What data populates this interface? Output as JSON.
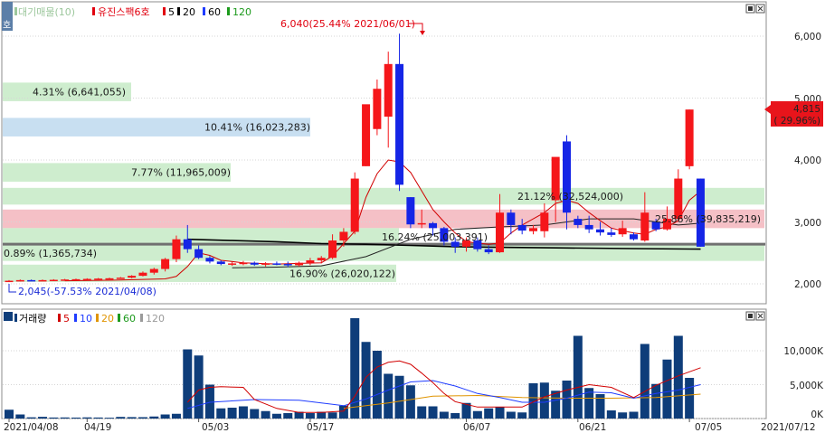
{
  "colors": {
    "up": "#f5161a",
    "down": "#1525e6",
    "ma5": "#d10000",
    "ma10": "#1f3cff",
    "ma20": "#e09400",
    "ma60": "#1c9a1c",
    "ma120": "#9a9a9a",
    "ma_trend": "#000000",
    "volume": "#0e3d7a",
    "band_green": "#c9ebc9",
    "band_blue": "#c2dcef",
    "band_red": "#f4b9c0",
    "price_tag": "#e8141b"
  },
  "price_panel": {
    "legend": {
      "item1": "대기매물(10)",
      "item2": "유진스팩6호",
      "ma5": "5",
      "ma20": "20",
      "ma60": "60",
      "ma120": "120"
    },
    "corner_tab": "호",
    "y_ticks": [
      "6,000",
      "5,000",
      "4,000",
      "3,000",
      "2,000"
    ],
    "max_annotation": "6,040(25.44% 2021/06/01)",
    "min_annotation": "2,045(-57.53% 2021/04/08)",
    "current_price": "4,815",
    "current_change": "( 29.96%)",
    "overhang_labels": [
      "4.31% (6,641,055)",
      "10.41% (16,023,283)",
      "7.77% (11,965,009)",
      "21.12% (32,524,000)",
      "25.86% (39,835,219)",
      "16.24% (25,003,391)",
      "0.89% (1,365,734)",
      "16.90% (26,020,122)"
    ]
  },
  "volume_panel": {
    "legend": {
      "title": "거래량",
      "ma5": "5",
      "ma10": "10",
      "ma20": "20",
      "ma60": "60",
      "ma120": "120"
    },
    "y_ticks": [
      "10,000K",
      "5,000K",
      "0K"
    ]
  },
  "x_ticks": [
    "2021/04/08",
    "04/19",
    "05/03",
    "05/17",
    "06/07",
    "06/21",
    "07/05",
    "2021/07/12"
  ],
  "chart_data": [
    {
      "type": "candlestick",
      "title": "유진스팩6호",
      "ylim": [
        1600,
        6500
      ],
      "y_ticks": [
        2000,
        3000,
        4000,
        5000,
        6000
      ],
      "candles": [
        [
          2045,
          2060,
          2040,
          2050
        ],
        [
          2050,
          2070,
          2040,
          2060
        ],
        [
          2060,
          2070,
          2050,
          2055
        ],
        [
          2055,
          2070,
          2050,
          2060
        ],
        [
          2060,
          2075,
          2050,
          2065
        ],
        [
          2065,
          2080,
          2055,
          2070
        ],
        [
          2070,
          2085,
          2060,
          2075
        ],
        [
          2075,
          2090,
          2065,
          2080
        ],
        [
          2080,
          2095,
          2070,
          2085
        ],
        [
          2085,
          2100,
          2075,
          2090
        ],
        [
          2090,
          2110,
          2080,
          2100
        ],
        [
          2100,
          2140,
          2090,
          2130
        ],
        [
          2130,
          2200,
          2120,
          2180
        ],
        [
          2180,
          2260,
          2150,
          2240
        ],
        [
          2240,
          2420,
          2200,
          2400
        ],
        [
          2400,
          2780,
          2350,
          2720
        ],
        [
          2720,
          2950,
          2500,
          2560
        ],
        [
          2560,
          2620,
          2400,
          2420
        ],
        [
          2420,
          2450,
          2330,
          2360
        ],
        [
          2360,
          2380,
          2300,
          2320
        ],
        [
          2320,
          2360,
          2290,
          2330
        ],
        [
          2330,
          2370,
          2300,
          2340
        ],
        [
          2340,
          2360,
          2290,
          2310
        ],
        [
          2310,
          2350,
          2280,
          2330
        ],
        [
          2330,
          2360,
          2300,
          2320
        ],
        [
          2320,
          2360,
          2270,
          2300
        ],
        [
          2300,
          2360,
          2280,
          2340
        ],
        [
          2340,
          2420,
          2300,
          2380
        ],
        [
          2380,
          2450,
          2330,
          2420
        ],
        [
          2420,
          2800,
          2400,
          2700
        ],
        [
          2700,
          2900,
          2600,
          2840
        ],
        [
          2840,
          3800,
          2800,
          3700
        ],
        [
          3900,
          4000,
          3900,
          4900
        ],
        [
          4500,
          5300,
          4400,
          5150
        ],
        [
          4700,
          5750,
          4200,
          5550
        ],
        [
          5550,
          6040,
          3500,
          3600
        ],
        [
          3400,
          3400,
          2900,
          2960
        ],
        [
          2960,
          3200,
          2900,
          2980
        ],
        [
          2980,
          3000,
          2780,
          2900
        ],
        [
          2900,
          2920,
          2620,
          2680
        ],
        [
          2680,
          2750,
          2500,
          2600
        ],
        [
          2600,
          2750,
          2520,
          2700
        ],
        [
          2700,
          2750,
          2520,
          2560
        ],
        [
          2560,
          2620,
          2480,
          2510
        ],
        [
          2510,
          3450,
          2500,
          3150
        ],
        [
          3150,
          3200,
          2800,
          2950
        ],
        [
          2950,
          3050,
          2800,
          2860
        ],
        [
          2850,
          2950,
          2800,
          2900
        ],
        [
          2850,
          3300,
          2750,
          3150
        ],
        [
          3350,
          3900,
          3000,
          4050
        ],
        [
          4300,
          4400,
          2880,
          3150
        ],
        [
          3050,
          3100,
          2900,
          2950
        ],
        [
          2950,
          3100,
          2820,
          2880
        ],
        [
          2880,
          3000,
          2780,
          2830
        ],
        [
          2830,
          2900,
          2760,
          2790
        ],
        [
          2800,
          3020,
          2760,
          2900
        ],
        [
          2800,
          2830,
          2700,
          2720
        ],
        [
          2700,
          3480,
          2680,
          3150
        ],
        [
          3000,
          3050,
          2850,
          2880
        ],
        [
          2880,
          3250,
          2860,
          3050
        ],
        [
          3050,
          3850,
          3000,
          3700
        ],
        [
          3900,
          4815,
          3850,
          4815
        ],
        [
          3700,
          3700,
          2600,
          2600
        ]
      ],
      "ma5": [
        [
          5,
          2050
        ],
        [
          10,
          2062
        ],
        [
          14,
          2080
        ],
        [
          15,
          2120
        ],
        [
          16,
          2280
        ],
        [
          17,
          2500
        ],
        [
          18,
          2460
        ],
        [
          19,
          2380
        ],
        [
          21,
          2340
        ],
        [
          24,
          2320
        ],
        [
          26,
          2330
        ],
        [
          28,
          2340
        ],
        [
          29,
          2450
        ],
        [
          30,
          2650
        ],
        [
          31,
          2850
        ],
        [
          32,
          3400
        ],
        [
          33,
          3780
        ],
        [
          34,
          4000
        ],
        [
          35,
          3970
        ],
        [
          36,
          3800
        ],
        [
          37,
          3500
        ],
        [
          38,
          3200
        ],
        [
          39,
          3000
        ],
        [
          40,
          2820
        ],
        [
          41,
          2680
        ],
        [
          43,
          2640
        ],
        [
          44,
          2660
        ],
        [
          45,
          2820
        ],
        [
          46,
          2950
        ],
        [
          47,
          3050
        ],
        [
          48,
          3150
        ],
        [
          49,
          3300
        ],
        [
          50,
          3350
        ],
        [
          51,
          3300
        ],
        [
          52,
          3150
        ],
        [
          53,
          3020
        ],
        [
          54,
          2900
        ],
        [
          55,
          2860
        ],
        [
          56,
          2820
        ],
        [
          57,
          2800
        ],
        [
          58,
          2880
        ],
        [
          59,
          2920
        ],
        [
          60,
          3020
        ],
        [
          61,
          3350
        ],
        [
          62,
          3500
        ]
      ],
      "ma_trend": [
        [
          16,
          2720
        ],
        [
          20,
          2700
        ],
        [
          24,
          2680
        ],
        [
          28,
          2650
        ],
        [
          32,
          2640
        ],
        [
          36,
          2620
        ],
        [
          40,
          2600
        ],
        [
          44,
          2590
        ],
        [
          50,
          2580
        ],
        [
          56,
          2570
        ],
        [
          62,
          2560
        ]
      ],
      "ma20": [
        [
          20,
          2260
        ],
        [
          24,
          2270
        ],
        [
          28,
          2290
        ],
        [
          32,
          2440
        ],
        [
          36,
          2720
        ],
        [
          40,
          2880
        ],
        [
          44,
          2920
        ],
        [
          48,
          2950
        ],
        [
          52,
          3050
        ],
        [
          56,
          3050
        ],
        [
          60,
          2950
        ],
        [
          62,
          2980
        ]
      ],
      "overhang_bands_price": [
        [
          4950,
          5250
        ],
        [
          4380,
          4680
        ],
        [
          3650,
          3950
        ],
        [
          3280,
          3550
        ],
        [
          2900,
          3200
        ],
        [
          2620,
          2900
        ],
        [
          2370,
          2620
        ],
        [
          2030,
          2310
        ]
      ],
      "support_line": 2640
    },
    {
      "type": "bar",
      "title": "거래량",
      "ylabel": "K",
      "ylim": [
        0,
        16000
      ],
      "values": [
        1300,
        600,
        180,
        250,
        150,
        160,
        140,
        170,
        150,
        120,
        240,
        210,
        200,
        300,
        600,
        700,
        10200,
        9300,
        5000,
        1500,
        1600,
        1800,
        1400,
        1100,
        700,
        800,
        1000,
        800,
        1000,
        900,
        1900,
        14800,
        11300,
        10000,
        6600,
        6300,
        4900,
        1800,
        1800,
        1000,
        800,
        2300,
        1100,
        1500,
        1700,
        1000,
        900,
        5200,
        5300,
        4100,
        5600,
        12200,
        4500,
        3600,
        1200,
        900,
        1000,
        11000,
        5100,
        8700,
        12200,
        6000
      ],
      "ma5": [
        [
          16,
          2400
        ],
        [
          17,
          4200
        ],
        [
          18,
          4600
        ],
        [
          19,
          4700
        ],
        [
          21,
          4600
        ],
        [
          22,
          2800
        ],
        [
          24,
          1500
        ],
        [
          26,
          900
        ],
        [
          28,
          900
        ],
        [
          30,
          1100
        ],
        [
          31,
          3300
        ],
        [
          32,
          6100
        ],
        [
          33,
          7600
        ],
        [
          34,
          8300
        ],
        [
          35,
          8500
        ],
        [
          36,
          8000
        ],
        [
          37,
          6700
        ],
        [
          38,
          5300
        ],
        [
          39,
          3700
        ],
        [
          40,
          2500
        ],
        [
          42,
          1700
        ],
        [
          44,
          1700
        ],
        [
          46,
          1700
        ],
        [
          48,
          3200
        ],
        [
          50,
          4200
        ],
        [
          52,
          5000
        ],
        [
          54,
          4600
        ],
        [
          56,
          3100
        ],
        [
          58,
          4900
        ],
        [
          60,
          6300
        ],
        [
          62,
          7500
        ]
      ],
      "ma10": [
        [
          16,
          1500
        ],
        [
          18,
          2400
        ],
        [
          22,
          2800
        ],
        [
          26,
          2700
        ],
        [
          30,
          1900
        ],
        [
          32,
          2900
        ],
        [
          34,
          4200
        ],
        [
          36,
          5400
        ],
        [
          38,
          5600
        ],
        [
          40,
          4800
        ],
        [
          42,
          3700
        ],
        [
          44,
          3100
        ],
        [
          46,
          2400
        ],
        [
          48,
          2400
        ],
        [
          50,
          3000
        ],
        [
          52,
          3900
        ],
        [
          54,
          3800
        ],
        [
          56,
          3000
        ],
        [
          58,
          3700
        ],
        [
          60,
          4200
        ],
        [
          62,
          5000
        ]
      ],
      "ma20": [
        [
          30,
          1500
        ],
        [
          34,
          2300
        ],
        [
          38,
          3300
        ],
        [
          42,
          3400
        ],
        [
          46,
          3100
        ],
        [
          50,
          3000
        ],
        [
          54,
          3000
        ],
        [
          58,
          3100
        ],
        [
          62,
          3600
        ]
      ]
    }
  ]
}
